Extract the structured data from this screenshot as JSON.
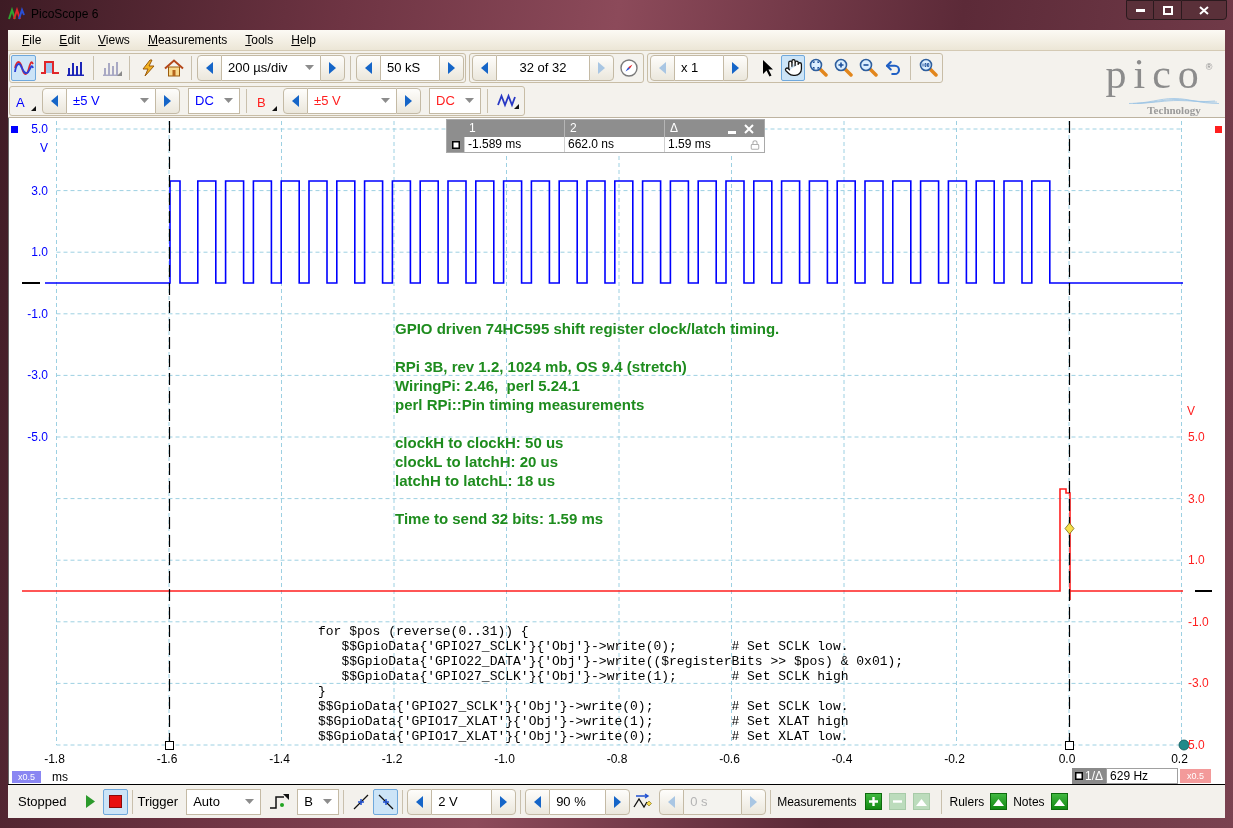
{
  "window": {
    "title": "PicoScope 6"
  },
  "menu": [
    {
      "label": "File"
    },
    {
      "label": "Edit"
    },
    {
      "label": "Views"
    },
    {
      "label": "Measurements"
    },
    {
      "label": "Tools"
    },
    {
      "label": "Help"
    }
  ],
  "toolbar": {
    "mode_buttons": [
      {
        "selected": true,
        "disabled": false
      },
      {
        "selected": false,
        "disabled": false
      },
      {
        "selected": false,
        "disabled": false
      },
      {
        "selected": false,
        "disabled": true
      }
    ],
    "timebase": "200 µs/div",
    "samples": "50 kS",
    "buffer": {
      "value": "32 of 32",
      "next_disabled": true
    },
    "zoom": {
      "value": "x 1",
      "previous_disabled": true
    },
    "tools": [
      {
        "selected": false
      },
      {
        "selected": true
      },
      {
        "selected": false
      },
      {
        "selected": false
      },
      {
        "selected": false
      },
      {
        "selected": false
      },
      {
        "selected": false
      }
    ],
    "channels": [
      {
        "name": "A",
        "range": "±5 V",
        "coupling": "DC",
        "color": "#0000ff"
      },
      {
        "name": "B",
        "range": "±5 V",
        "coupling": "DC",
        "color": "#ff1f1f"
      }
    ]
  },
  "logo": {
    "name": "pico",
    "mark": "®",
    "tagline": "Technology"
  },
  "plot": {
    "left_axis": {
      "unit": "V",
      "ticks": [
        "5.0",
        "3.0",
        "1.0",
        "-1.0",
        "-3.0",
        "-5.0"
      ],
      "scale": "x0.5"
    },
    "right_axis": {
      "unit": "V",
      "ticks": [
        "5.0",
        "3.0",
        "1.0",
        "-1.0",
        "-3.0",
        "5.0"
      ],
      "scale": "x0.5"
    },
    "x_axis": {
      "unit": "ms",
      "ticks": [
        "-1.8",
        "-1.6",
        "-1.4",
        "-1.2",
        "-1.0",
        "-0.8",
        "-0.6",
        "-0.4",
        "-0.2",
        "0.0",
        "0.2"
      ]
    },
    "ruler_table": {
      "headers": [
        "1",
        "2",
        "Δ"
      ],
      "values": [
        "-1.589 ms",
        "662.0 ns",
        "1.59 ms"
      ]
    },
    "frequency": {
      "label": "1/Δ",
      "value": "629 Hz"
    },
    "note": [
      [
        "GPIO driven 74HC595 shift register clock/latch timing."
      ],
      [
        "RPi 3B, rev 1.2, 1024 mb, OS 9.4 (stretch)",
        "WiringPi: 2.46,  perl 5.24.1",
        "perl RPi::Pin timing measurements"
      ],
      [
        "clockH to clockH: 50 us",
        "clockL to latchH: 20 us",
        "latchH to latchL: 18 us"
      ],
      [
        "Time to send 32 bits: 1.59 ms"
      ]
    ],
    "code": [
      "for $pos (reverse(0..31)) {",
      "   $$GpioData{'GPIO27_SCLK'}{'Obj'}->write(0);       # Set SCLK low.",
      "   $$GpioData{'GPIO22_DATA'}{'Obj'}->write(($registerBits >> $pos) & 0x01);",
      "   $$GpioData{'GPIO27_SCLK'}{'Obj'}->write(1);       # Set SCLK high",
      "}",
      "$$GpioData{'GPIO27_SCLK'}{'Obj'}->write(0);          # Set SCLK low.",
      "$$GpioData{'GPIO17_XLAT'}{'Obj'}->write(1);          # Set XLAT high",
      "$$GpioData{'GPIO17_XLAT'}{'Obj'}->write(0);          # Set XLAT low."
    ]
  },
  "status_bar": {
    "state": "Stopped",
    "run_buttons": [
      {
        "selected": false
      },
      {
        "selected": true
      }
    ],
    "trigger_label": "Trigger",
    "trigger_mode": "Auto",
    "trigger_source": "B",
    "edge_buttons": [
      {
        "selected": false
      },
      {
        "selected": true
      }
    ],
    "threshold": "2 V",
    "pre_trigger": "90 %",
    "delay": {
      "value": "0 s",
      "disabled": true
    },
    "measurements": {
      "label": "Measurements",
      "buttons": [
        {
          "disabled": false
        },
        {
          "disabled": true
        },
        {
          "disabled": true
        }
      ]
    },
    "rulers": {
      "label": "Rulers"
    },
    "notes": {
      "label": "Notes"
    }
  }
}
